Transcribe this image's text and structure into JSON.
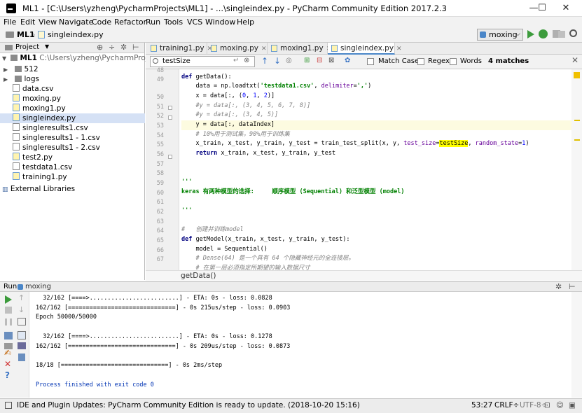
{
  "window": {
    "title": "ML1 - [C:\\Users\\yzheng\\PycharmProjects\\ML1] - ...\\singleindex.py - PyCharm Community Edition 2017.2.3",
    "minimize": "—",
    "maximize": "☐",
    "close": "✕"
  },
  "menu": [
    "File",
    "Edit",
    "View",
    "Navigate",
    "Code",
    "Refactor",
    "Run",
    "Tools",
    "VCS",
    "Window",
    "Help"
  ],
  "nav": {
    "crumb_project": "ML1",
    "crumb_file": "singleindex.py",
    "run_config": "moxing"
  },
  "project": {
    "header": "Project",
    "root_name": "ML1",
    "root_path": "C:\\Users\\yzheng\\PycharmProjects\\ML",
    "items": [
      {
        "label": "512",
        "type": "folder"
      },
      {
        "label": "logs",
        "type": "folder"
      },
      {
        "label": "data.csv",
        "type": "csv"
      },
      {
        "label": "moxing.py",
        "type": "py"
      },
      {
        "label": "moxing1.py",
        "type": "py"
      },
      {
        "label": "singleindex.py",
        "type": "py"
      },
      {
        "label": "singleresults1.csv",
        "type": "csv"
      },
      {
        "label": "singleresults1 - 1.csv",
        "type": "csv"
      },
      {
        "label": "singleresults1 - 2.csv",
        "type": "csv"
      },
      {
        "label": "test2.py",
        "type": "py"
      },
      {
        "label": "testdata1.csv",
        "type": "csv"
      },
      {
        "label": "training1.py",
        "type": "py"
      }
    ],
    "external": "External Libraries"
  },
  "tabs": [
    "training1.py",
    "moxing.py",
    "moxing1.py",
    "singleindex.py"
  ],
  "search": {
    "query": "testSize",
    "match_case": "Match Case",
    "regex": "Regex",
    "words": "Words",
    "matches": "4 matches"
  },
  "editor": {
    "line_numbers": [
      "48",
      "49",
      "50",
      "51",
      "52",
      "53",
      "54",
      "55",
      "56",
      "57",
      "58",
      "59",
      "60",
      "61",
      "62",
      "63",
      "64",
      "65",
      "66",
      "67"
    ],
    "breadcrumb": "getData()"
  },
  "run": {
    "label": "Run",
    "config": "moxing",
    "lines": [
      "  32/162 [====>.........................] - ETA: 0s - loss: 0.0828",
      "162/162 [==============================] - 0s 215us/step - loss: 0.0903",
      "Epoch 50000/50000",
      "",
      "  32/162 [====>.........................] - ETA: 0s - loss: 0.1278",
      "162/162 [==============================] - 0s 209us/step - loss: 0.0873",
      "",
      "18/18 [==============================] - 0s 2ms/step",
      "",
      "Process finished with exit code 0"
    ]
  },
  "status": {
    "message": "IDE and Plugin Updates: PyCharm Community Edition is ready to update. (2018-10-20 15:16)",
    "position": "53:27",
    "line_sep": "CRLF÷",
    "encoding": "UTF-8÷"
  },
  "colors": {
    "keyword": "#000080",
    "string": "#008000",
    "number": "#0000ff",
    "comment": "#808080",
    "highlight": "#ffff00",
    "selection": "#d5e1f5"
  }
}
